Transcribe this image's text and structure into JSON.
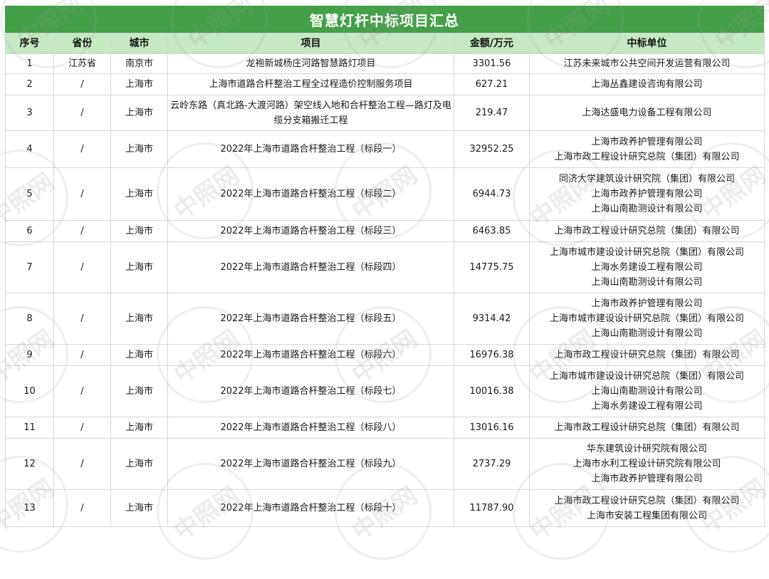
{
  "title": "智慧灯杆中标项目汇总",
  "watermark_text": "中照网",
  "columns": [
    "序号",
    "省份",
    "城市",
    "项目",
    "金额/万元",
    "中标单位"
  ],
  "rows": [
    {
      "no": "1",
      "province": "江苏省",
      "city": "南京市",
      "project": "龙袍新城杨庄河路智慧路灯项目",
      "amount": "3301.56",
      "units": [
        "江苏未来城市公共空间开发运营有限公司"
      ]
    },
    {
      "no": "2",
      "province": "/",
      "city": "上海市",
      "project": "上海市道路合杆整治工程全过程造价控制服务项目",
      "amount": "627.21",
      "units": [
        "上海丛鑫建设咨询有限公司"
      ]
    },
    {
      "no": "3",
      "province": "/",
      "city": "上海市",
      "project": "云岭东路（真北路-大渡河路）架空线入地和合杆整治工程—路灯及电缆分支箱搬迁工程",
      "amount": "219.47",
      "units": [
        "上海达盛电力设备工程有限公司"
      ]
    },
    {
      "no": "4",
      "province": "/",
      "city": "上海市",
      "project": "2022年上海市道路合杆整治工程（标段一）",
      "amount": "32952.25",
      "units": [
        "上海市政养护管理有限公司",
        "上海市政工程设计研究总院（集团）有限公司"
      ]
    },
    {
      "no": "5",
      "province": "/",
      "city": "上海市",
      "project": "2022年上海市道路合杆整治工程（标段二）",
      "amount": "6944.73",
      "units": [
        "同济大学建筑设计研究院（集团）有限公司",
        "上海市政养护管理有限公司",
        "上海山南勘测设计有限公司"
      ]
    },
    {
      "no": "6",
      "province": "/",
      "city": "上海市",
      "project": "2022年上海市道路合杆整治工程（标段三）",
      "amount": "6463.85",
      "units": [
        "上海市政工程设计研究总院（集团）有限公司"
      ]
    },
    {
      "no": "7",
      "province": "/",
      "city": "上海市",
      "project": "2022年上海市道路合杆整治工程（标段四）",
      "amount": "14775.75",
      "units": [
        "上海市城市建设设计研究总院（集团）有限公司",
        "上海水务建设工程有限公司",
        "上海山南勘测设计有限公司"
      ]
    },
    {
      "no": "8",
      "province": "/",
      "city": "上海市",
      "project": "2022年上海市道路合杆整治工程（标段五）",
      "amount": "9314.42",
      "units": [
        "上海市政养护管理有限公司",
        "上海市城市建设设计研究总院（集团）有限公司",
        "上海山南勘测设计有限公司"
      ]
    },
    {
      "no": "9",
      "province": "/",
      "city": "上海市",
      "project": "2022年上海市道路合杆整治工程（标段六）",
      "amount": "16976.38",
      "units": [
        "上海市政工程设计研究总院（集团）有限公司"
      ]
    },
    {
      "no": "10",
      "province": "/",
      "city": "上海市",
      "project": "2022年上海市道路合杆整治工程（标段七）",
      "amount": "10016.38",
      "units": [
        "上海市城市建设设计研究总院（集团）有限公司",
        "上海山南勘测设计有限公司",
        "上海水务建设工程有限公司"
      ]
    },
    {
      "no": "11",
      "province": "/",
      "city": "上海市",
      "project": "2022年上海市道路合杆整治工程（标段八）",
      "amount": "13016.16",
      "units": [
        "上海市政工程设计研究总院（集团）有限公司"
      ]
    },
    {
      "no": "12",
      "province": "/",
      "city": "上海市",
      "project": "2022年上海市道路合杆整治工程（标段九）",
      "amount": "2737.29",
      "units": [
        "华东建筑设计研究院有限公司",
        "上海市水利工程设计研究院有限公司",
        "上海市政养护管理有限公司"
      ]
    },
    {
      "no": "13",
      "province": "/",
      "city": "上海市",
      "project": "2022年上海市道路合杆整治工程（标段十）",
      "amount": "11787.90",
      "units": [
        "上海市政工程设计研究总院（集团）有限公司",
        "上海市安装工程集团有限公司"
      ]
    }
  ]
}
